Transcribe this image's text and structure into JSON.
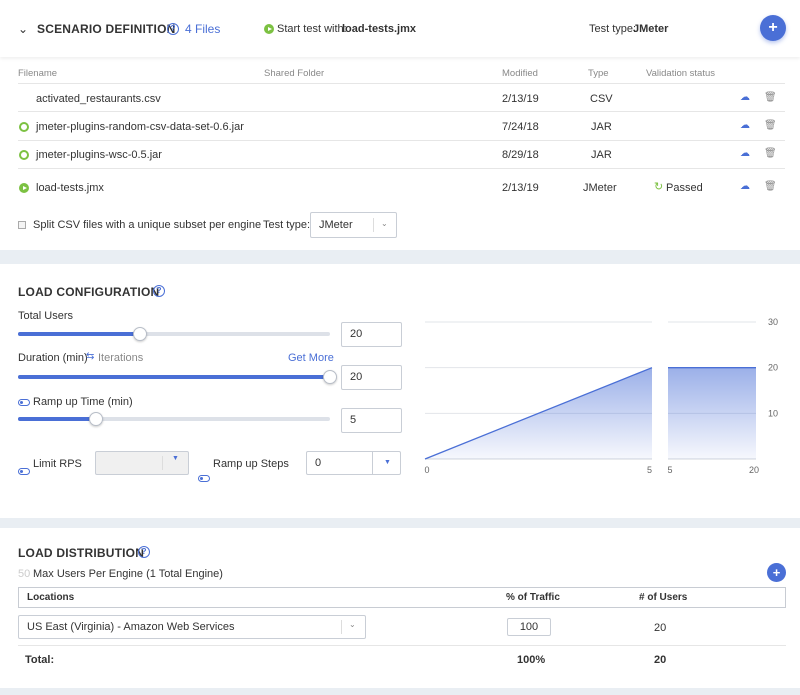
{
  "scenario": {
    "title": "SCENARIO DEFINITION",
    "files_count": "4 Files",
    "start_label": "Start test with:",
    "start_file": "load-tests.jmx",
    "test_type_label": "Test type:",
    "test_type_value": "JMeter",
    "columns": [
      "Filename",
      "Shared Folder",
      "Modified",
      "Type",
      "Validation status"
    ],
    "files": [
      {
        "name": "activated_restaurants.csv",
        "modified": "2/13/19",
        "type": "CSV",
        "status": "",
        "marker": "none"
      },
      {
        "name": "jmeter-plugins-random-csv-data-set-0.6.jar",
        "modified": "7/24/18",
        "type": "JAR",
        "status": "",
        "marker": "ring"
      },
      {
        "name": "jmeter-plugins-wsc-0.5.jar",
        "modified": "8/29/18",
        "type": "JAR",
        "status": "",
        "marker": "ring"
      },
      {
        "name": "load-tests.jmx",
        "modified": "2/13/19",
        "type": "JMeter",
        "status": "Passed",
        "marker": "start"
      }
    ],
    "split_label": "Split CSV files with a unique subset per engine",
    "bottom_type_label": "Test type:",
    "bottom_type_value": "JMeter"
  },
  "load": {
    "title": "LOAD CONFIGURATION",
    "total_users_label": "Total Users",
    "total_users_value": "20",
    "total_users_fraction": 0.39,
    "duration_label": "Duration (min)",
    "iterations_label": "Iterations",
    "get_more": "Get More",
    "duration_value": "20",
    "duration_fraction": 1.0,
    "rampup_label": "Ramp up Time (min)",
    "rampup_value": "5",
    "rampup_fraction": 0.25,
    "limit_rps_label": "Limit RPS",
    "limit_rps_value": "",
    "ramp_steps_label": "Ramp up Steps",
    "ramp_steps_value": "0"
  },
  "chart_data": {
    "type": "area",
    "yticks": [
      "30",
      "20",
      "10"
    ],
    "ylim": [
      0,
      30
    ],
    "series": [
      {
        "x": [
          0,
          5
        ],
        "y": [
          0,
          20
        ]
      },
      {
        "x": [
          5,
          20
        ],
        "y": [
          20,
          20
        ]
      }
    ],
    "xtick_labels": [
      "0",
      "5",
      "5",
      "20"
    ],
    "color": "#4a6fd6"
  },
  "distribution": {
    "title": "LOAD DISTRIBUTION",
    "max_users_value": "50",
    "max_users_label": "Max Users Per Engine (1 Total Engine)",
    "col_locations": "Locations",
    "col_traffic": "% of Traffic",
    "col_users": "# of Users",
    "location": "US East (Virginia) - Amazon Web Services",
    "traffic": "100",
    "users": "20",
    "total_label": "Total:",
    "total_traffic": "100%",
    "total_users": "20"
  }
}
